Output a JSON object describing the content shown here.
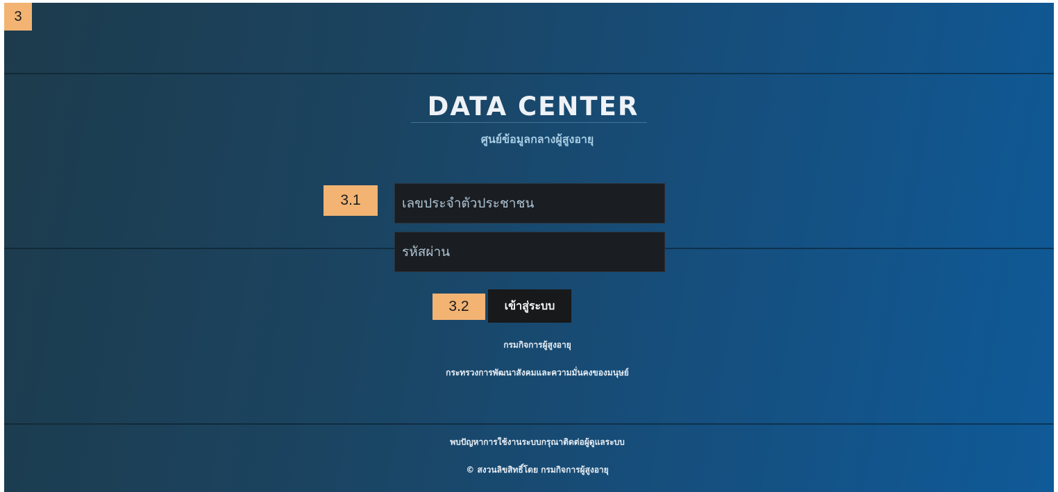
{
  "annotations": {
    "screen_marker": "3",
    "credentials_marker": "3.1",
    "login_marker": "3.2"
  },
  "header": {
    "title": "DATA CENTER",
    "subtitle": "ศูนย์ข้อมูลกลางผู้สูงอายุ"
  },
  "form": {
    "id_placeholder": "เลขประจำตัวประชาชน",
    "password_placeholder": "รหัสผ่าน",
    "login_label": "เข้าสู่ระบบ"
  },
  "footer": {
    "department": "กรมกิจการผู้สูงอายุ",
    "ministry": "กระทรวงการพัฒนาสังคมและความมั่นคงของมนุษย์",
    "help": "พบปัญหาการใช้งานระบบกรุณาติดต่อผู้ดูแลระบบ",
    "copyright": "© สงวนลิขสิทธิ์โดย กรมกิจการผู้สูงอายุ"
  },
  "colors": {
    "background_start": "#1d3b4c",
    "background_end": "#0f5a98",
    "marker": "#f2b373",
    "input_bg": "#1a1d21",
    "button_bg": "#17191b"
  }
}
